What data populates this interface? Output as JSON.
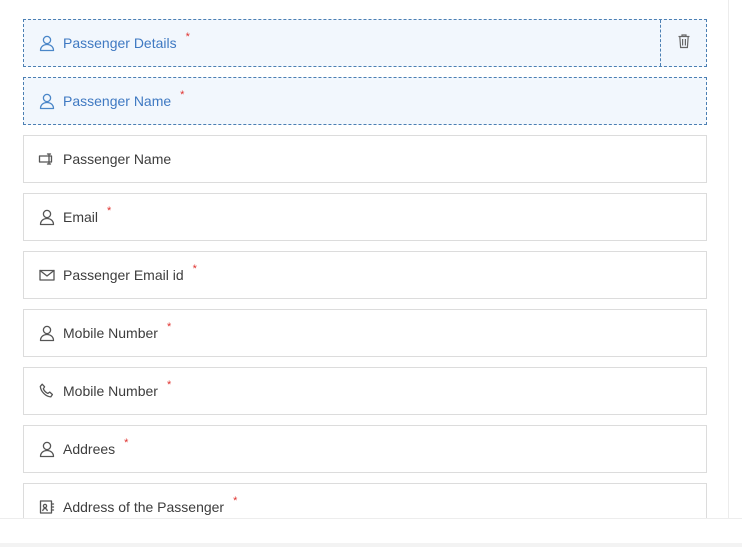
{
  "fields": [
    {
      "label": "Passenger Details",
      "icon": "user-icon",
      "required": "*",
      "selected": true
    },
    {
      "label": "Passenger Name",
      "icon": "user-icon",
      "required": "*",
      "selected": true
    },
    {
      "label": "Passenger Name",
      "icon": "text-input-icon",
      "required": ""
    },
    {
      "label": "Email",
      "icon": "user-icon",
      "required": "*"
    },
    {
      "label": "Passenger Email id",
      "icon": "mail-icon",
      "required": "*"
    },
    {
      "label": "Mobile Number",
      "icon": "user-icon",
      "required": "*"
    },
    {
      "label": "Mobile Number",
      "icon": "phone-icon",
      "required": "*"
    },
    {
      "label": "Addrees",
      "icon": "user-icon",
      "required": "*"
    },
    {
      "label": "Address of the Passenger",
      "icon": "address-card-icon",
      "required": "*"
    }
  ],
  "colors": {
    "selected_border": "#4b7fb3",
    "selected_bg": "#f2f7fd",
    "selected_label": "#3f79c2",
    "required": "#e0322f"
  },
  "icons": {
    "delete": "trash-icon"
  }
}
